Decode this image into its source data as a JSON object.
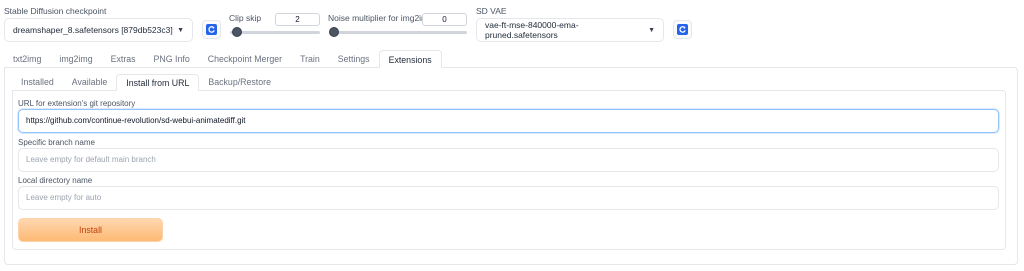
{
  "checkpoint": {
    "label": "Stable Diffusion checkpoint",
    "value": "dreamshaper_8.safetensors [879db523c3]",
    "refresh_icon": "refresh-icon"
  },
  "clip_skip": {
    "label": "Clip skip",
    "value": "2",
    "fraction": 0.08
  },
  "noise_multiplier": {
    "label": "Noise multiplier for img2img",
    "value": "0",
    "fraction": 0.0
  },
  "vae": {
    "label": "SD VAE",
    "value": "vae-ft-mse-840000-ema-pruned.safetensors",
    "refresh_icon": "refresh-icon"
  },
  "main_tabs": [
    "txt2img",
    "img2img",
    "Extras",
    "PNG Info",
    "Checkpoint Merger",
    "Train",
    "Settings",
    "Extensions"
  ],
  "main_tab_active": "Extensions",
  "sub_tabs": [
    "Installed",
    "Available",
    "Install from URL",
    "Backup/Restore"
  ],
  "sub_tab_active": "Install from URL",
  "form": {
    "url_label": "URL for extension's git repository",
    "url_value": "https://github.com/continue-revolution/sd-webui-animatediff.git",
    "branch_label": "Specific branch name",
    "branch_placeholder": "Leave empty for default main branch",
    "dir_label": "Local directory name",
    "dir_placeholder": "Leave empty for auto",
    "install_label": "Install"
  },
  "colors": {
    "accent": "#2563eb",
    "install_bg": "#fdba74",
    "install_text": "#c2410c"
  }
}
